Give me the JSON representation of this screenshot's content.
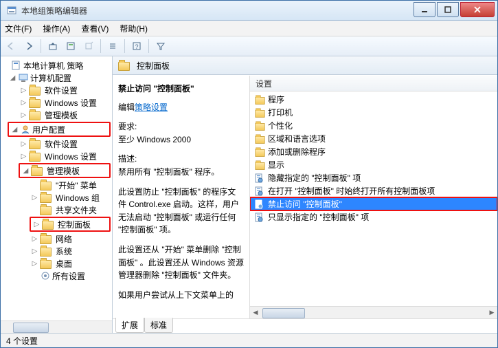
{
  "window": {
    "title": "本地组策略编辑器"
  },
  "menubar": [
    "文件(F)",
    "操作(A)",
    "查看(V)",
    "帮助(H)"
  ],
  "tree": {
    "root": "本地计算机 策略",
    "n1": "计算机配置",
    "n1a": "软件设置",
    "n1b": "Windows 设置",
    "n1c": "管理模板",
    "n2": "用户配置",
    "n2a": "软件设置",
    "n2b": "Windows 设置",
    "n2c": "管理模板",
    "n2c1": "\"开始\" 菜单",
    "n2c2": "Windows 组",
    "n2c3": "共享文件夹",
    "n2c4": "控制面板",
    "n2c5": "网络",
    "n2c6": "系统",
    "n2c7": "桌面",
    "n2c8": "所有设置"
  },
  "header": {
    "title": "控制面板"
  },
  "desc": {
    "title": "禁止访问 \"控制面板\"",
    "edit_prefix": "编辑",
    "edit_link": "策略设置",
    "req_label": "要求:",
    "req_value": "至少 Windows 2000",
    "desc_label": "描述:",
    "p1": "禁用所有 \"控制面板\" 程序。",
    "p2": "此设置防止 \"控制面板\" 的程序文件 Control.exe 启动。这样，用户无法启动 \"控制面板\" 或运行任何 \"控制面板\" 项。",
    "p3": "此设置还从 \"开始\" 菜单删除 \"控制面板\" 。此设置还从 Windows 资源管理器删除 \"控制面板\" 文件夹。",
    "p4": "如果用户尝试从上下文菜单上的"
  },
  "settings": {
    "col": "设置",
    "items": [
      {
        "type": "folder",
        "label": "程序"
      },
      {
        "type": "folder",
        "label": "打印机"
      },
      {
        "type": "folder",
        "label": "个性化"
      },
      {
        "type": "folder",
        "label": "区域和语言选项"
      },
      {
        "type": "folder",
        "label": "添加或删除程序"
      },
      {
        "type": "folder",
        "label": "显示"
      },
      {
        "type": "file",
        "label": "隐藏指定的 \"控制面板\" 项"
      },
      {
        "type": "file",
        "label": "在打开 \"控制面板\" 时始终打开所有控制面板项"
      },
      {
        "type": "file",
        "label": "禁止访问 \"控制面板\"",
        "selected": true
      },
      {
        "type": "file",
        "label": "只显示指定的 \"控制面板\" 项"
      }
    ]
  },
  "tabs": {
    "extended": "扩展",
    "standard": "标准"
  },
  "status": "4 个设置"
}
